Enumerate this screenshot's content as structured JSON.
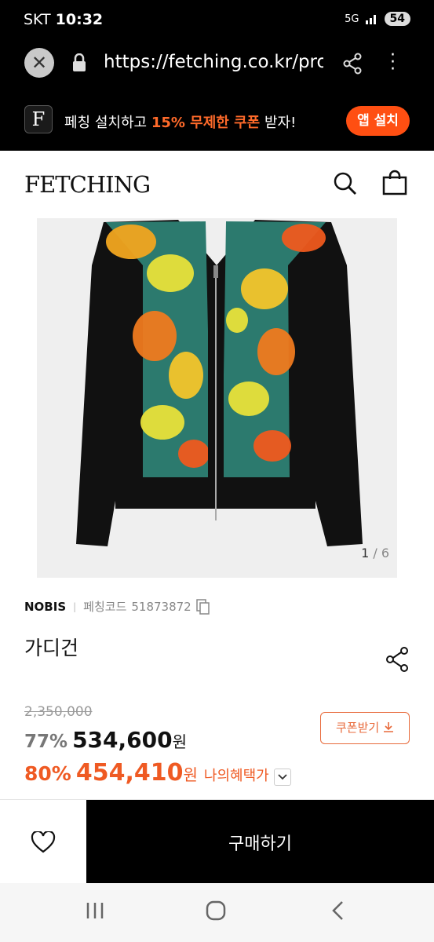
{
  "status": {
    "carrier": "SKT",
    "time": "10:32",
    "network": "5G",
    "battery": "54"
  },
  "browser": {
    "url": "https://fetching.co.kr/proc"
  },
  "banner": {
    "logo": "F",
    "text_before": "페칭 설치하고 ",
    "text_highlight": "15% 무제한 쿠폰",
    "text_after": " 받자!",
    "install_label": "앱 설치",
    "accent": "#ff4f12"
  },
  "header": {
    "brand": "FETCHING"
  },
  "gallery": {
    "current": "1",
    "separator": " / ",
    "total": "6"
  },
  "product": {
    "brand": "NOBIS",
    "code_label": "페칭코드",
    "code": "51873872",
    "title": "가디건",
    "original_price": "2,350,000",
    "discount1": "77%",
    "price1": "534,600",
    "won": "원",
    "discount2": "80%",
    "price2": "454,410",
    "benefit_label": "나의혜택가"
  },
  "coupon": {
    "label": "쿠폰받기"
  },
  "actions": {
    "buy_label": "구매하기"
  },
  "colors": {
    "price_accent": "#ef5a23",
    "coupon_border": "#e86a3b"
  }
}
